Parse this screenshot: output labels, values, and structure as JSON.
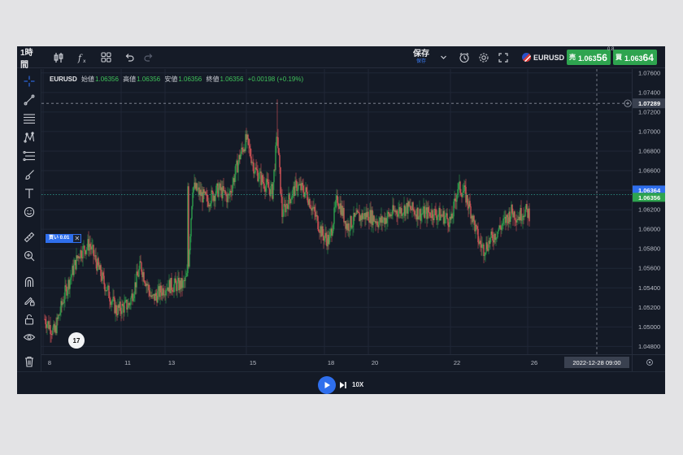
{
  "toolbar": {
    "interval": "1時間",
    "save_label": "保存",
    "save_sublabel": "保存",
    "icons": [
      "candles-icon",
      "indicators-fx-icon",
      "layout-grid-icon",
      "undo-icon",
      "redo-icon",
      "chevron-down-icon",
      "alert-clock-icon",
      "settings-gear-icon",
      "fullscreen-icon"
    ]
  },
  "symbol": {
    "name": "EURUSD"
  },
  "trade": {
    "sell_label": "売",
    "sell_price_main": "1.063",
    "sell_price_big": "56",
    "buy_label": "買",
    "buy_price_main": "1.063",
    "buy_price_big": "64",
    "spread": "0.8"
  },
  "left_tools": [
    "crosshair-icon",
    "trend-line-icon",
    "parallel-lines-icon",
    "pattern-icon",
    "fib-icon",
    "brush-icon",
    "text-icon",
    "emoji-icon",
    "ruler-icon",
    "zoom-in-icon",
    "magnet-icon",
    "lock-pencil-icon",
    "unlock-icon",
    "eye-icon",
    "trash-icon"
  ],
  "legend": {
    "symbol": "EURUSD",
    "open_label": "始値",
    "open": "1.06356",
    "high_label": "高値",
    "high": "1.06356",
    "low_label": "安値",
    "low": "1.06356",
    "close_label": "終値",
    "close": "1.06356",
    "change": "+0.00198 (+0.19%)"
  },
  "order_tag": {
    "label": "買い 0.01",
    "close": "✕"
  },
  "crosshair": {
    "price": "1.07289",
    "date": "2022-12-28  09:00"
  },
  "price_labels": {
    "ask": "1.06364",
    "bid": "1.06356"
  },
  "watermark": "17",
  "playback": {
    "speed": "10X"
  },
  "colors": {
    "up": "#2fa84f",
    "down": "#e2575a",
    "accent": "#2f6fed",
    "background": "#141a26"
  },
  "chart_data": {
    "type": "candlestick",
    "y_ticks": [
      1.076,
      1.074,
      1.072,
      1.07,
      1.068,
      1.066,
      1.064,
      1.062,
      1.06,
      1.058,
      1.056,
      1.054,
      1.052,
      1.05,
      1.048
    ],
    "y_tick_labels": [
      "1.07600",
      "1.07400",
      "1.07200",
      "1.07000",
      "1.06800",
      "1.06600",
      "1.06400",
      "1.06200",
      "1.06000",
      "1.05800",
      "1.05600",
      "1.05400",
      "1.05200",
      "1.05000",
      "1.04800"
    ],
    "ylim": [
      1.0472,
      1.0764
    ],
    "x_ticks": [
      "8",
      "11",
      "13",
      "15",
      "18",
      "20",
      "22",
      "26"
    ],
    "current_bid": 1.06356,
    "current_ask": 1.06364,
    "crosshair_price": 1.07289,
    "path": [
      [
        0,
        1.0508
      ],
      [
        12,
        1.0494
      ],
      [
        25,
        1.0535
      ],
      [
        42,
        1.0575
      ],
      [
        55,
        1.0585
      ],
      [
        72,
        1.0547
      ],
      [
        88,
        1.0517
      ],
      [
        104,
        1.0523
      ],
      [
        118,
        1.0563
      ],
      [
        132,
        1.0528
      ],
      [
        150,
        1.0542
      ],
      [
        170,
        1.0543
      ],
      [
        176,
        1.0552
      ],
      [
        182,
        1.0644
      ],
      [
        200,
        1.0629
      ],
      [
        214,
        1.0641
      ],
      [
        226,
        1.0632
      ],
      [
        240,
        1.0675
      ],
      [
        248,
        1.0692
      ],
      [
        258,
        1.0662
      ],
      [
        268,
        1.0649
      ],
      [
        280,
        1.0638
      ],
      [
        286,
        1.0698
      ],
      [
        292,
        1.0615
      ],
      [
        298,
        1.0627
      ],
      [
        310,
        1.0645
      ],
      [
        322,
        1.0637
      ],
      [
        342,
        1.0594
      ],
      [
        350,
        1.0588
      ],
      [
        360,
        1.0632
      ],
      [
        372,
        1.0603
      ],
      [
        384,
        1.0612
      ],
      [
        398,
        1.0615
      ],
      [
        412,
        1.0607
      ],
      [
        430,
        1.0618
      ],
      [
        446,
        1.0622
      ],
      [
        462,
        1.0616
      ],
      [
        476,
        1.0617
      ],
      [
        492,
        1.0613
      ],
      [
        500,
        1.0608
      ],
      [
        508,
        1.0643
      ],
      [
        516,
        1.0638
      ],
      [
        524,
        1.0619
      ],
      [
        534,
        1.0587
      ],
      [
        540,
        1.058
      ],
      [
        552,
        1.0593
      ],
      [
        566,
        1.0608
      ],
      [
        574,
        1.0618
      ],
      [
        582,
        1.0613
      ],
      [
        590,
        1.0619
      ],
      [
        596,
        1.0616
      ]
    ]
  }
}
